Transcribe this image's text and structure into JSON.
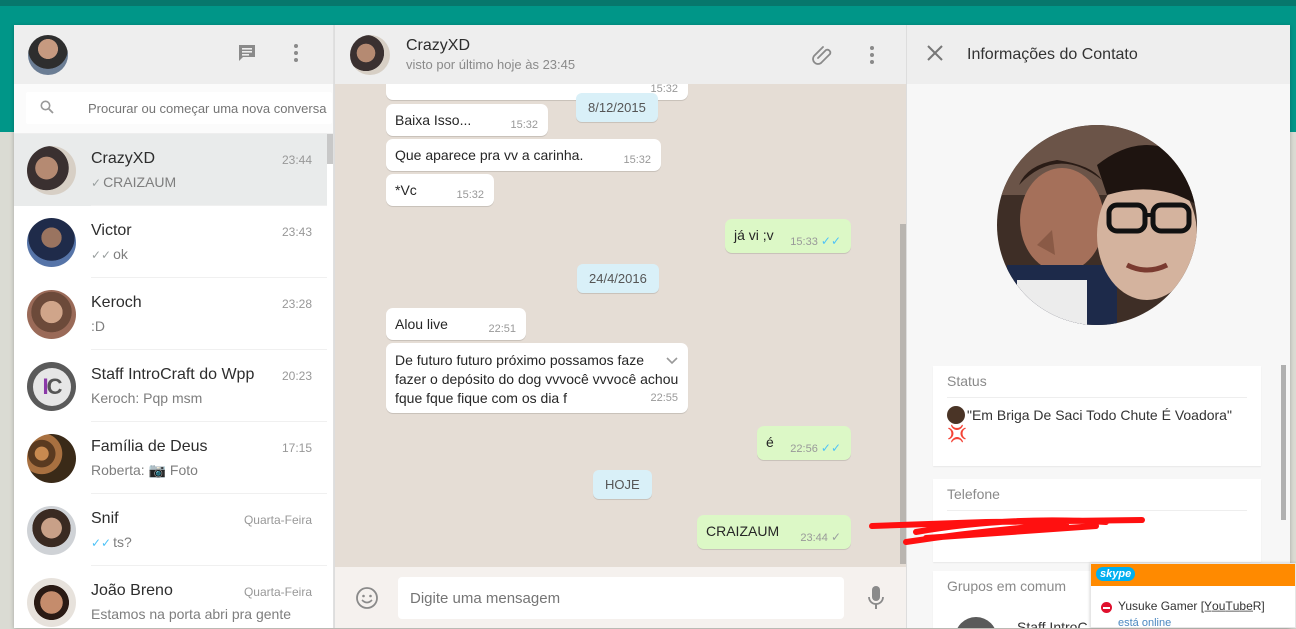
{
  "sidebar": {
    "search_placeholder": "Procurar ou começar uma nova conversa",
    "chats": [
      {
        "name": "CrazyXD",
        "time": "23:44",
        "tick": "✓",
        "preview": "CRAIZAUM"
      },
      {
        "name": "Victor",
        "time": "23:43",
        "tick": "✓✓",
        "preview": "ok"
      },
      {
        "name": "Keroch",
        "time": "23:28",
        "tick": "",
        "preview": ":D"
      },
      {
        "name": "Staff IntroCraft do Wpp",
        "time": "20:23",
        "tick": "",
        "preview": "Keroch: Pqp msm"
      },
      {
        "name": "Família de Deus",
        "time": "17:15",
        "tick": "",
        "preview": "Roberta: 📷 Foto"
      },
      {
        "name": "Snif",
        "time": "Quarta-Feira",
        "tick": "✓✓",
        "preview": "ts?"
      },
      {
        "name": "João Breno",
        "time": "Quarta-Feira",
        "tick": "",
        "preview": "Estamos na porta abri pra gente"
      }
    ]
  },
  "chat": {
    "contact_name": "CrazyXD",
    "contact_status": "visto por último hoje às 23:45",
    "top_time": "15:32",
    "dates": {
      "d1": "8/12/2015",
      "d2": "24/4/2016",
      "d3": "HOJE"
    },
    "messages": [
      {
        "text": "Baixa Isso...",
        "time": "15:32"
      },
      {
        "text": "Que aparece pra vv a carinha.",
        "time": "15:32"
      },
      {
        "text": "*Vc",
        "time": "15:32"
      },
      {
        "text": "já vi ;v",
        "time": "15:33"
      },
      {
        "text": "Alou live",
        "time": "22:51"
      },
      {
        "text": "De futuro futuro próximo possamos faze",
        "text2": "fazer o depósito do dog vvvocê vvvocê achou",
        "text3": "fque fque fique com os dia f",
        "time": "22:55"
      },
      {
        "text": "é",
        "time": "22:56"
      },
      {
        "text": "CRAIZAUM",
        "time": "23:44"
      }
    ],
    "composer_placeholder": "Digite uma mensagem"
  },
  "info": {
    "title": "Informações do Contato",
    "status_label": "Status",
    "status_value": "\"Em Briga De Saci Todo Chute É Voadora\"",
    "phone_label": "Telefone",
    "groups_label": "Grupos em comum",
    "group_partial": "Staff IntroC"
  },
  "skype": {
    "logo": "skype",
    "name": "Yusuke Gamer [Y̲o̲u̲T̲u̲b̲e̲R]",
    "status": "está online"
  },
  "colors": {
    "teal": "#009688",
    "bubble_out": "#dcf8c6",
    "read_tick": "#4fc3f7",
    "skype_orange": "#ff8a00"
  }
}
